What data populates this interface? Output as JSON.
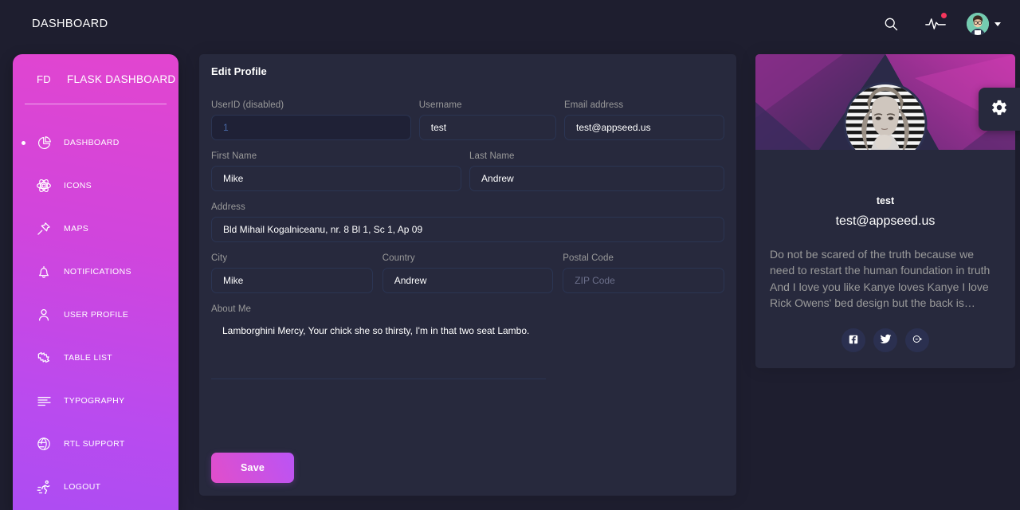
{
  "navbar": {
    "brand": "DASHBOARD",
    "search_icon": "search-icon",
    "activity_icon": "pulse-activity-icon",
    "avatar_icon": "user-avatar",
    "caret_icon": "chevron-down-icon"
  },
  "sidebar": {
    "logo_mini": "FD",
    "logo_text": "FLASK DASHBOARD",
    "items": [
      {
        "label": "DASHBOARD",
        "icon": "chart-pie-icon",
        "active": true
      },
      {
        "label": "ICONS",
        "icon": "atom-icon",
        "active": false
      },
      {
        "label": "MAPS",
        "icon": "pin-icon",
        "active": false
      },
      {
        "label": "NOTIFICATIONS",
        "icon": "bell-icon",
        "active": false
      },
      {
        "label": "USER PROFILE",
        "icon": "user-icon",
        "active": false
      },
      {
        "label": "TABLE LIST",
        "icon": "puzzle-icon",
        "active": false
      },
      {
        "label": "TYPOGRAPHY",
        "icon": "text-align-icon",
        "active": false
      },
      {
        "label": "RTL SUPPORT",
        "icon": "globe-icon",
        "active": false
      },
      {
        "label": "LOGOUT",
        "icon": "running-man-icon",
        "active": false
      }
    ]
  },
  "edit_profile": {
    "title": "Edit Profile",
    "fields": {
      "userid": {
        "label": "UserID (disabled)",
        "value": "1",
        "placeholder": "",
        "disabled": true
      },
      "username": {
        "label": "Username",
        "value": "test",
        "placeholder": ""
      },
      "email": {
        "label": "Email address",
        "value": "test@appseed.us",
        "placeholder": ""
      },
      "first_name": {
        "label": "First Name",
        "value": "Mike",
        "placeholder": ""
      },
      "last_name": {
        "label": "Last Name",
        "value": "Andrew",
        "placeholder": ""
      },
      "address": {
        "label": "Address",
        "value": "Bld Mihail Kogalniceanu, nr. 8 Bl 1, Sc 1, Ap 09",
        "placeholder": ""
      },
      "city": {
        "label": "City",
        "value": "Mike",
        "placeholder": ""
      },
      "country": {
        "label": "Country",
        "value": "Andrew",
        "placeholder": ""
      },
      "postal_code": {
        "label": "Postal Code",
        "value": "",
        "placeholder": "ZIP Code"
      },
      "about_me": {
        "label": "About Me",
        "value": "Lamborghini Mercy, Your chick she so thirsty, I'm in that two seat Lambo.",
        "placeholder": ""
      }
    },
    "save_label": "Save"
  },
  "profile_card": {
    "name": "test",
    "email": "test@appseed.us",
    "description": "Do not be scared of the truth because we need to restart the human foundation in truth And I love you like Kanye loves Kanye I love Rick Owens' bed design but the back is…",
    "social": [
      {
        "name": "facebook-icon",
        "glyph": "f"
      },
      {
        "name": "twitter-icon",
        "glyph": "t"
      },
      {
        "name": "google-plus-icon",
        "glyph": "g"
      }
    ]
  },
  "fixed_plugin": {
    "icon": "gear-icon"
  },
  "colors": {
    "page_bg": "#1e1e2f",
    "card_bg": "#27293d",
    "sidebar_top": "#e245cf",
    "sidebar_bottom": "#ad4cf2",
    "accent_pink": "#e14eca",
    "accent_purple": "#ba54f5",
    "input_border": "#2b3553",
    "label_gray": "#9a9a9a",
    "notif_dot": "#f5365c"
  }
}
